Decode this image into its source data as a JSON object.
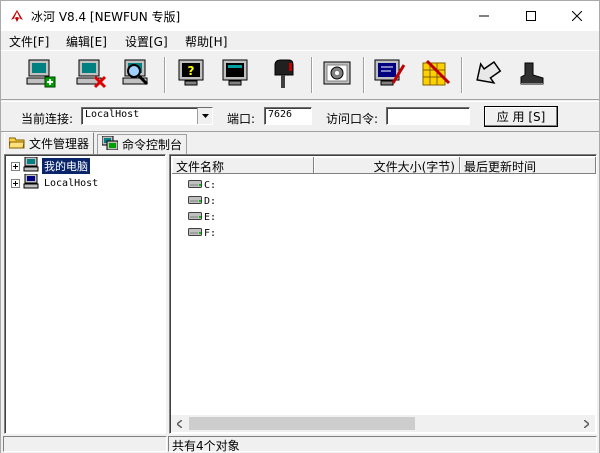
{
  "window": {
    "title": "冰河 V8.4 [NEWFUN 专版]",
    "minimize_icon": "minimize-icon",
    "maximize_icon": "maximize-icon",
    "close_icon": "close-icon"
  },
  "menu": {
    "items": [
      "文件[F]",
      "编辑[E]",
      "设置[G]",
      "帮助[H]"
    ]
  },
  "toolbar": {
    "icons": [
      "add-host-icon",
      "delete-host-icon",
      "search-host-icon",
      "help-monitor-icon",
      "screen-capture-icon",
      "mailbox-icon",
      "config-icon",
      "edit-monitor-icon",
      "tools-icon",
      "back-arrow-icon",
      "exit-boot-icon"
    ]
  },
  "connection": {
    "current_label": "当前连接:",
    "current_value": "LocalHost",
    "port_label": "端口:",
    "port_value": "7626",
    "password_label": "访问口令:",
    "password_value": "",
    "apply_label": "应 用 [S]"
  },
  "tabs": [
    {
      "label": "文件管理器",
      "icon": "folder-icon"
    },
    {
      "label": "命令控制台",
      "icon": "console-icon"
    }
  ],
  "tree": {
    "items": [
      {
        "label": "我的电脑",
        "selected": true
      },
      {
        "label": "LocalHost",
        "selected": false
      }
    ]
  },
  "list": {
    "columns": [
      "文件名称",
      "文件大小(字节)",
      "最后更新时间"
    ],
    "rows": [
      "C:",
      "D:",
      "E:",
      "F:"
    ]
  },
  "status": {
    "text": "共有4个对象"
  }
}
